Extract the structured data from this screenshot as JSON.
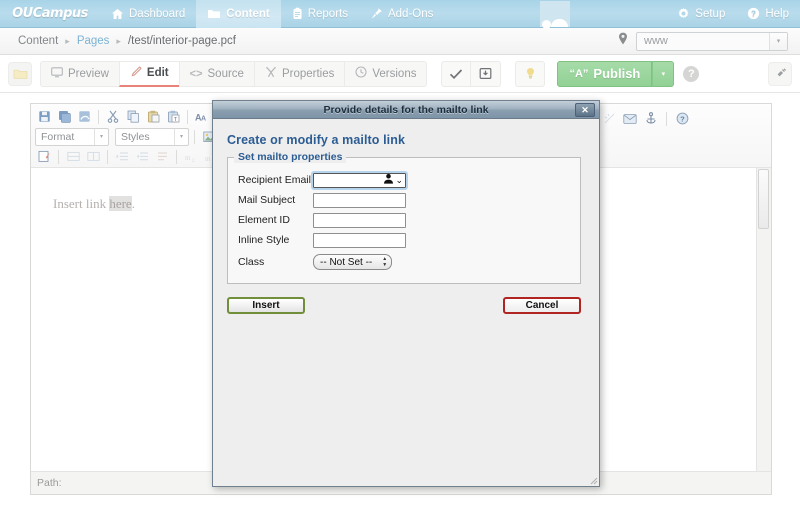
{
  "topnav": {
    "logo": "OUCampus",
    "items": [
      {
        "label": "Dashboard",
        "icon": "home-icon",
        "active": false
      },
      {
        "label": "Content",
        "icon": "folder-icon",
        "active": true
      },
      {
        "label": "Reports",
        "icon": "clipboard-icon",
        "active": false
      },
      {
        "label": "Add-Ons",
        "icon": "pin-icon",
        "active": false
      }
    ],
    "right_items": [
      {
        "label": "Setup",
        "icon": "gear-icon"
      },
      {
        "label": "Help",
        "icon": "question-circle-icon"
      }
    ],
    "avatar": "user-avatar",
    "bg_color": "#b2d8ea"
  },
  "breadcrumb": {
    "items": [
      {
        "label": "Content",
        "type": "text"
      },
      {
        "label": "Pages",
        "type": "link"
      },
      {
        "label": "/test/interior-page.pcf",
        "type": "path"
      }
    ],
    "separator": "▸"
  },
  "site_picker": {
    "icon": "location-pin-icon",
    "value": "www",
    "placeholder": "www",
    "caret": "▾"
  },
  "action_bar": {
    "folder_button": "folder-icon",
    "tabs": [
      {
        "label": "Preview",
        "icon": "monitor-icon",
        "active": false
      },
      {
        "label": "Edit",
        "icon": "pencil-icon",
        "active": true
      },
      {
        "label": "Source",
        "icon": "code-icon",
        "active": false
      },
      {
        "label": "Properties",
        "icon": "wrench-icon",
        "active": false
      },
      {
        "label": "Versions",
        "icon": "clock-icon",
        "active": false
      }
    ],
    "save_icon": "checkmark-icon",
    "snapshot_icon": "save-to-disk-icon",
    "bulb_icon": "lightbulb-icon",
    "publish_label": "Publish",
    "publish_icon": "speaker-a-icon",
    "publish_caret": "▾",
    "help_badge": "?",
    "plug_icon": "plug-icon",
    "accent_publish": "#92d195",
    "accent_active_tab": "#e8837a"
  },
  "editor": {
    "toolbar_row1": [
      "save-icon",
      "save-all-icon",
      "revert-icon",
      "SEP",
      "cut-icon",
      "copy-icon",
      "paste-icon",
      "paste-text-icon",
      "SEP",
      "find-icon",
      "replace-icon"
    ],
    "toolbar_row2_selects": [
      {
        "label": "Format"
      },
      {
        "label": "Styles"
      }
    ],
    "toolbar_row2_icons": [
      "image-icon",
      "table-icon"
    ],
    "toolbar_row3": [
      "edit-source-icon",
      "SEP",
      "row-icon",
      "cell-icon",
      "SEP",
      "indent-icon",
      "outdent-icon",
      "blockquote-icon",
      "SEP",
      "subscript-icon",
      "superscript-icon",
      "special-char-icon"
    ],
    "toolbar_row_right": [
      "spellcheck-icon",
      "mailto-icon",
      "anchor-icon",
      "SEP",
      "help-icon"
    ],
    "body_text_before": "Insert link ",
    "body_text_selected": "here",
    "body_text_after": ".",
    "status_label": "Path:"
  },
  "modal": {
    "titlebar": "Provide details for the mailto link",
    "close_label": "✕",
    "heading": "Create or modify a mailto link",
    "legend": "Set mailto properties",
    "fields": [
      {
        "label": "Recipient Email",
        "value": "",
        "type": "text-with-picker",
        "focused": true,
        "picker_icon": "person-icon",
        "picker_caret": "⌄"
      },
      {
        "label": "Mail Subject",
        "value": "",
        "type": "text",
        "focused": false
      },
      {
        "label": "Element ID",
        "value": "",
        "type": "text",
        "focused": false
      },
      {
        "label": "Inline Style",
        "value": "",
        "type": "text",
        "focused": false
      }
    ],
    "class_field": {
      "label": "Class",
      "value": "-- Not Set --",
      "options": [
        "-- Not Set --"
      ]
    },
    "insert_label": "Insert",
    "cancel_label": "Cancel",
    "insert_accent": "#718f3a",
    "cancel_accent": "#b02521"
  }
}
